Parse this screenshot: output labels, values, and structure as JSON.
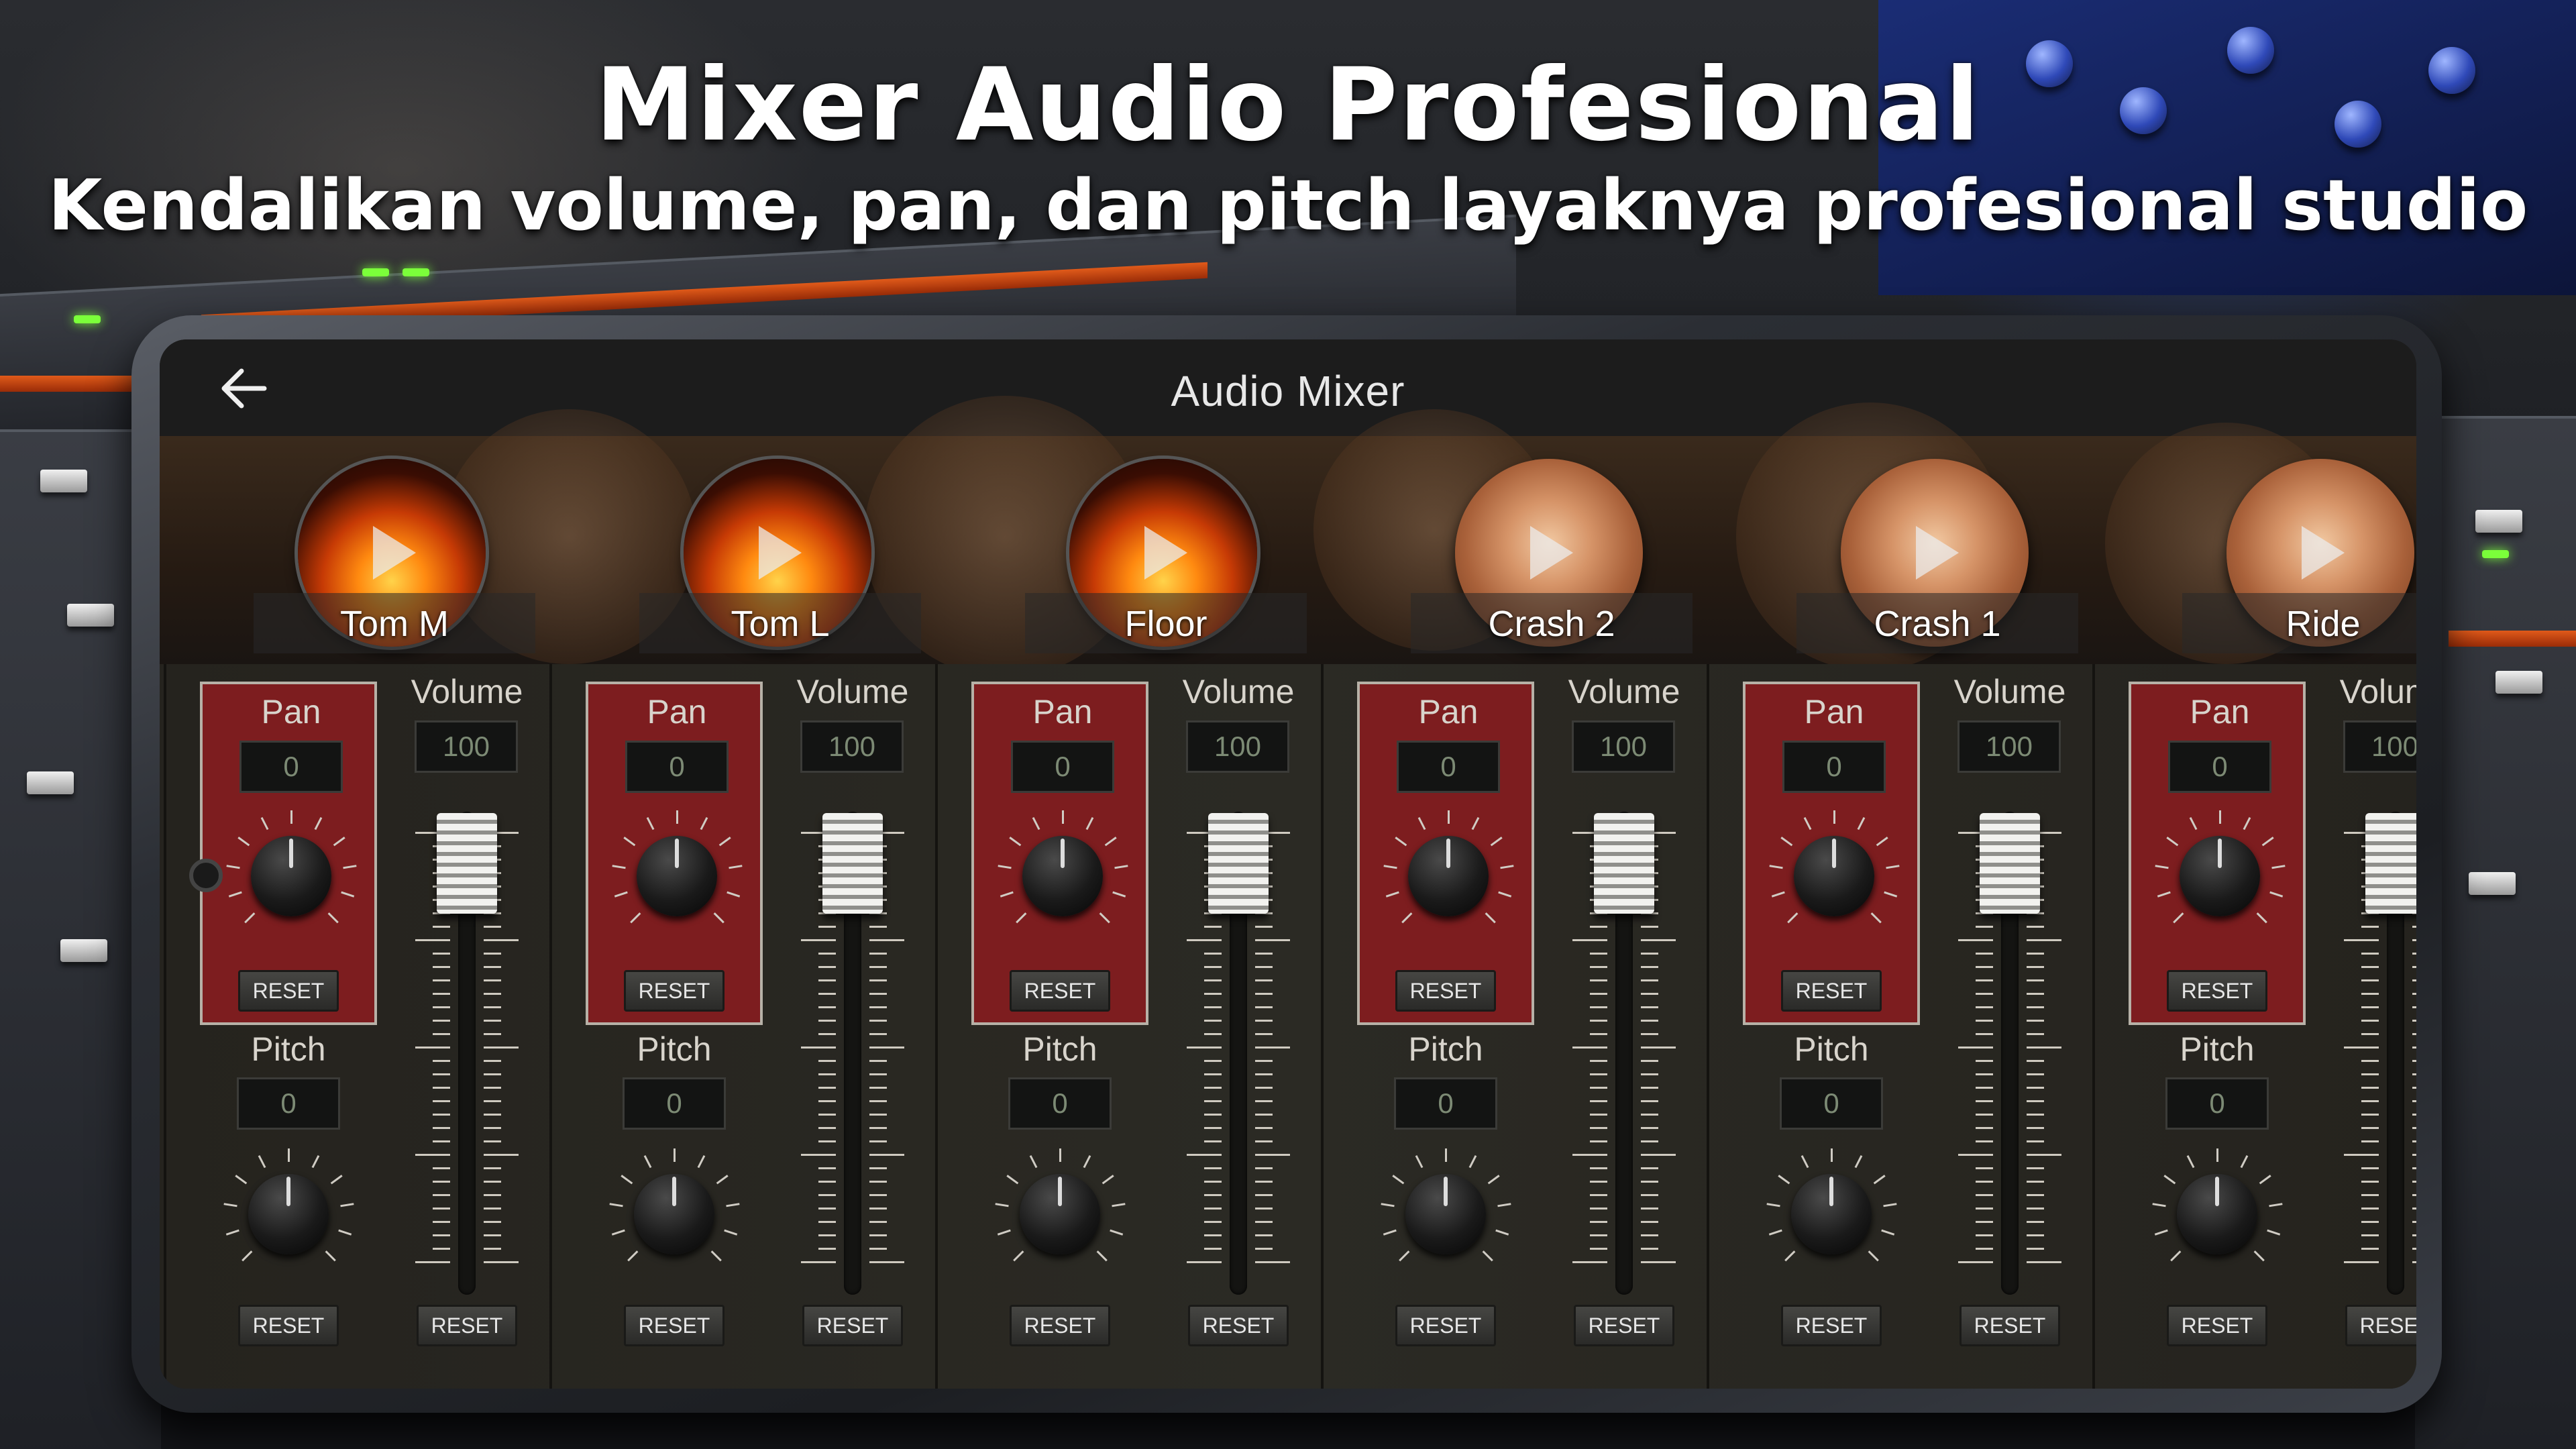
{
  "promo": {
    "title": "Mixer Audio Profesional",
    "subtitle": "Kendalikan volume, pan, dan pitch layaknya profesional studio"
  },
  "app": {
    "screen_title": "Audio Mixer",
    "back_icon": "arrow-left-icon"
  },
  "instruments": [
    {
      "label": "Tom M",
      "style": "drum"
    },
    {
      "label": "Tom L",
      "style": "drum"
    },
    {
      "label": "Floor",
      "style": "drum"
    },
    {
      "label": "Crash 2",
      "style": "cymbal"
    },
    {
      "label": "Crash 1",
      "style": "cymbal"
    },
    {
      "label": "Ride",
      "style": "cymbal"
    }
  ],
  "labels": {
    "pan": "Pan",
    "pitch": "Pitch",
    "volume": "Volume",
    "reset": "RESET"
  },
  "channels": [
    {
      "pan": "0",
      "pitch": "0",
      "volume": "100"
    },
    {
      "pan": "0",
      "pitch": "0",
      "volume": "100"
    },
    {
      "pan": "0",
      "pitch": "0",
      "volume": "100"
    },
    {
      "pan": "0",
      "pitch": "0",
      "volume": "100"
    },
    {
      "pan": "0",
      "pitch": "0",
      "volume": "100"
    },
    {
      "pan": "0",
      "pitch": "0",
      "volume": "100"
    }
  ],
  "colors": {
    "pan_panel": "#7d1d1f",
    "background": "#201f1b"
  }
}
